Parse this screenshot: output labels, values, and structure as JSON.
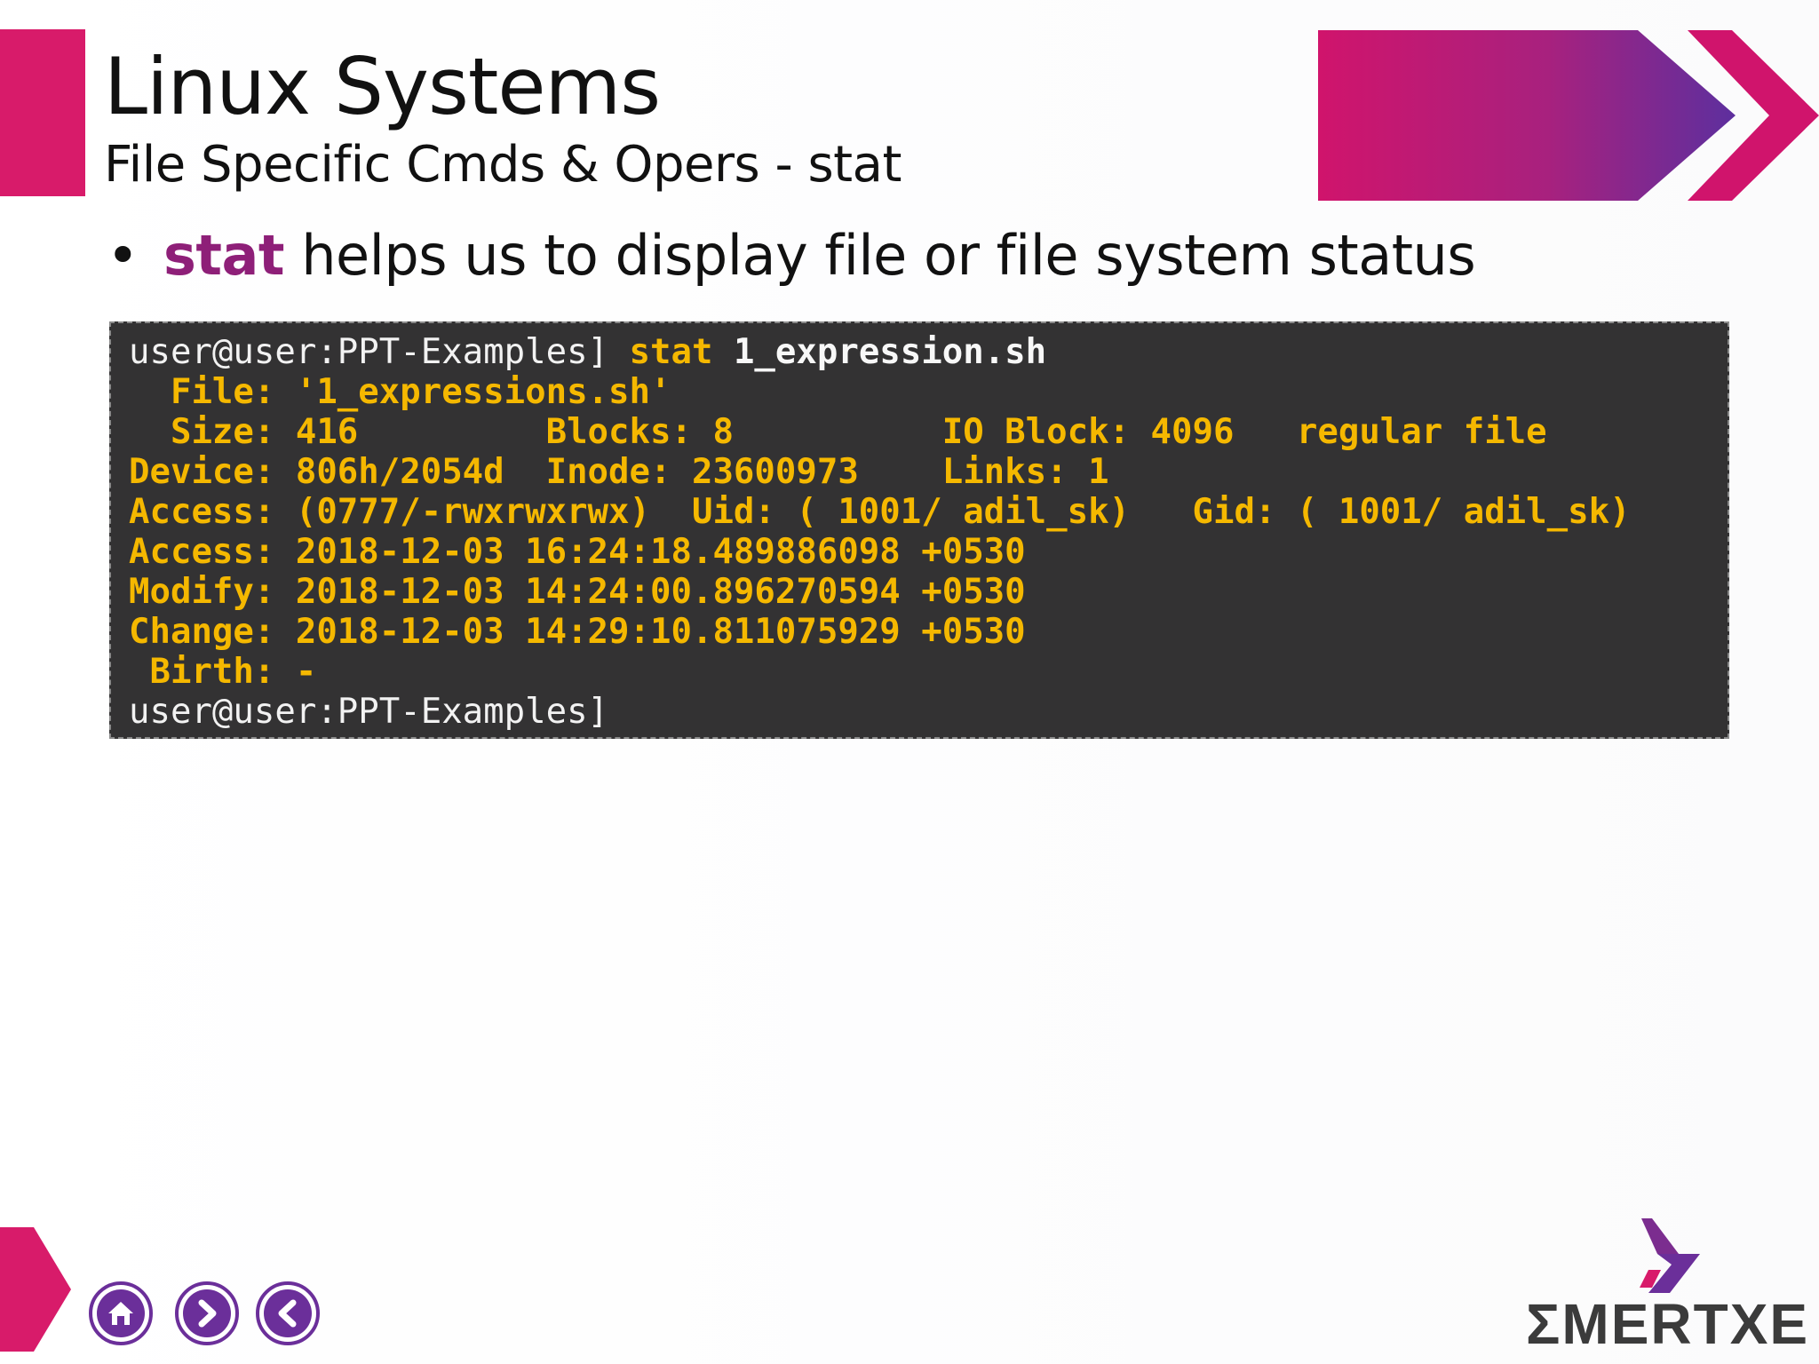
{
  "slide": {
    "title": "Linux Systems",
    "subtitle": "File Specific Cmds & Opers - stat",
    "bullet": {
      "marker": "•",
      "keyword": "stat",
      "text": " helps us to display file or file system status"
    }
  },
  "terminal": {
    "prompt": "user@user:PPT-Examples]",
    "command": "stat",
    "argument": "1_expression.sh",
    "output_lines": [
      "  File: '1_expressions.sh'",
      "  Size: 416         Blocks: 8          IO Block: 4096   regular file",
      "Device: 806h/2054d  Inode: 23600973    Links: 1",
      "Access: (0777/-rwxrwxrwx)  Uid: ( 1001/ adil_sk)   Gid: ( 1001/ adil_sk)",
      "Access: 2018-12-03 16:24:18.489886098 +0530",
      "Modify: 2018-12-03 14:24:00.896270594 +0530",
      "Change: 2018-12-03 14:29:10.811075929 +0530",
      " Birth: -"
    ],
    "final_prompt": "user@user:PPT-Examples]"
  },
  "navigation": {
    "home_icon": "home-icon",
    "next_icon": "chevron-right-icon",
    "prev_icon": "chevron-left-icon"
  },
  "logo": {
    "text": "ΣMERTXE"
  },
  "colors": {
    "accent_pink": "#d81b6a",
    "accent_purple": "#6b2f9a",
    "keyword": "#8e1f78",
    "terminal_bg": "#333233",
    "terminal_highlight": "#f5b800"
  }
}
